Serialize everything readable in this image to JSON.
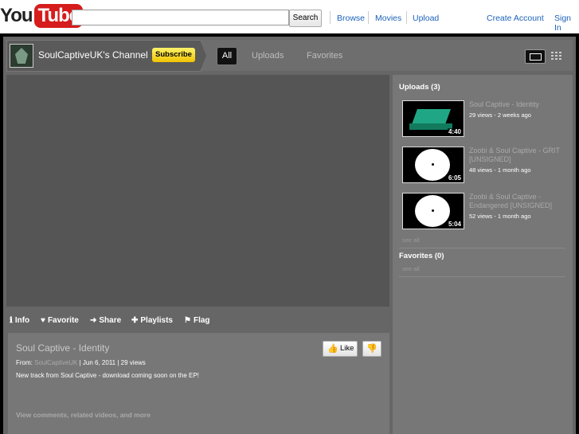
{
  "masthead": {
    "logo_you": "You",
    "logo_tube": "Tube",
    "search_value": "",
    "search_button": "Search",
    "nav": [
      "Browse",
      "Movies",
      "Upload"
    ],
    "create_account": "Create Account",
    "sign_in": "Sign In"
  },
  "channel": {
    "name": "SoulCaptiveUK's Channel",
    "subscribe": "Subscribe",
    "tabs": [
      "All",
      "Uploads",
      "Favorites"
    ],
    "active_tab": "All"
  },
  "actions": {
    "info": "Info",
    "favorite": "Favorite",
    "share": "Share",
    "playlists": "Playlists",
    "flag": "Flag"
  },
  "video": {
    "title": "Soul Captive - Identity",
    "from_label": "From:",
    "uploader": "SoulCaptiveUK",
    "date": "| Jun 6, 2011",
    "views": "| 29 views",
    "description": "New track from Soul Captive - download coming soon on the EP!",
    "more": "View comments, related videos, and more",
    "like": "Like"
  },
  "sidebar": {
    "uploads_heading": "Uploads (3)",
    "uploads": [
      {
        "title": "Soul Captive - Identity",
        "meta": "29 views - 2 weeks ago",
        "duration": "4:40"
      },
      {
        "title": "Zoobi & Soul Captive - GRIT [UNSIGNED]",
        "meta": "48 views - 1 month ago",
        "duration": "6:05"
      },
      {
        "title": "Zoobi & Soul Captive - Endangered [UNSIGNED]",
        "meta": "52 views - 1 month ago",
        "duration": "5:04"
      }
    ],
    "see_all": "see all",
    "favorites_heading": "Favorites (0)",
    "favorites_see_all": "see all"
  },
  "colors": {
    "accent_link": "#1c62b9",
    "logo_red": "#d61c1c",
    "subscribe_yellow": "#f0c400",
    "panel_grey": "#777777"
  }
}
